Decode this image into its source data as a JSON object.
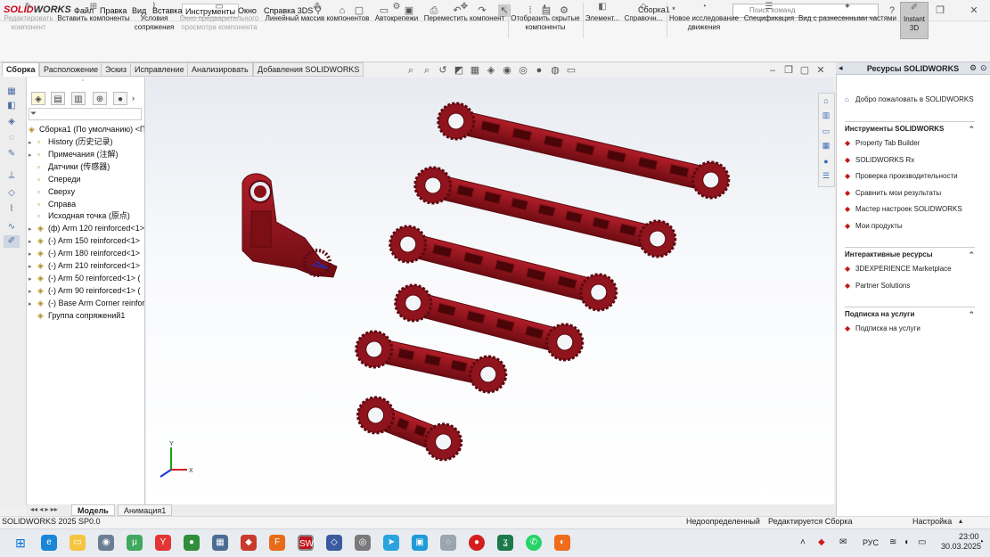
{
  "app": {
    "logo_brand": "SOLID",
    "logo_works": "WORKS",
    "doc_title": "Сборка1 *"
  },
  "menu": [
    "Файл",
    "Правка",
    "Вид",
    "Вставка",
    "Инструменты",
    "Окно",
    "Справка 3DS"
  ],
  "search": {
    "placeholder": "Поиск команд"
  },
  "commands": [
    {
      "label": "Редактировать компонент",
      "disabled": true
    },
    {
      "label": "Вставить компоненты"
    },
    {
      "label": "Условия сопряжения"
    },
    {
      "label": "Окно предварительного просмотра компонента",
      "disabled": true
    },
    {
      "label": "Линейный массив компонентов"
    },
    {
      "label": "Автокрепежи"
    },
    {
      "label": "Переместить компонент"
    },
    {
      "label": "Отобразить скрытые компоненты"
    },
    {
      "label": "Элемент..."
    },
    {
      "label": "Справочн..."
    },
    {
      "label": "Новое исследование движения"
    },
    {
      "label": "Спецификация"
    },
    {
      "label": "Вид с разнесенными частями"
    },
    {
      "label": "Instant 3D",
      "highlighted": true
    }
  ],
  "tabs": [
    "Сборка",
    "Расположение",
    "Эскиз",
    "Исправление",
    "Анализировать",
    "Добавления SOLIDWORKS"
  ],
  "tree": {
    "root": "Сборка1 (По умолчанию) <П",
    "items": [
      {
        "label": "History (历史记录)",
        "exp": true
      },
      {
        "label": "Примечания (注解)",
        "exp": true
      },
      {
        "label": "Датчики (传感器)",
        "exp": false
      },
      {
        "label": "Спереди",
        "exp": false
      },
      {
        "label": "Сверху",
        "exp": false
      },
      {
        "label": "Справа",
        "exp": false
      },
      {
        "label": "Исходная точка (原点)",
        "exp": false
      },
      {
        "label": "(ф) Arm 120 reinforced<1>",
        "exp": true
      },
      {
        "label": "(-) Arm 150 reinforced<1>",
        "exp": true
      },
      {
        "label": "(-) Arm 180 reinforced<1>",
        "exp": true
      },
      {
        "label": "(-) Arm 210 reinforced<1>",
        "exp": true
      },
      {
        "label": "(-) Arm 50 reinforced<1> (",
        "exp": true
      },
      {
        "label": "(-) Arm 90 reinforced<1> (",
        "exp": true
      },
      {
        "label": "(-) Base Arm Corner reinfor",
        "exp": true
      },
      {
        "label": "Группа сопряжений1",
        "exp": false
      }
    ]
  },
  "bottom_tabs": [
    "Модель",
    "Анимация1"
  ],
  "status": {
    "version": "SOLIDWORKS 2025 SP0.0",
    "state": "Недоопределенный",
    "editing": "Редактируется Сборка",
    "custom": "Настройка"
  },
  "resources": {
    "title": "Ресурсы SOLIDWORKS",
    "welcome": "Добро пожаловать в SOLIDWORKS",
    "sections": [
      {
        "title": "Инструменты SOLIDWORKS",
        "items": [
          "Property Tab Builder",
          "SOLIDWORKS Rx",
          "Проверка производительности",
          "Сравнить мои результаты",
          "Мастер настроек SOLIDWORKS",
          "Мои продукты"
        ]
      },
      {
        "title": "Интерактивные ресурсы",
        "items": [
          "3DEXPERIENCE Marketplace",
          "Partner Solutions"
        ]
      },
      {
        "title": "Подписка на услуги",
        "items": [
          "Подписка на услуги"
        ]
      }
    ]
  },
  "taskbar": {
    "lang": "РУС",
    "time": "23:00",
    "date": "30.03.2025"
  },
  "colors": {
    "part": "#9b1620",
    "accent": "#d0021b"
  },
  "triad": {
    "x": "X",
    "y": "Y"
  }
}
